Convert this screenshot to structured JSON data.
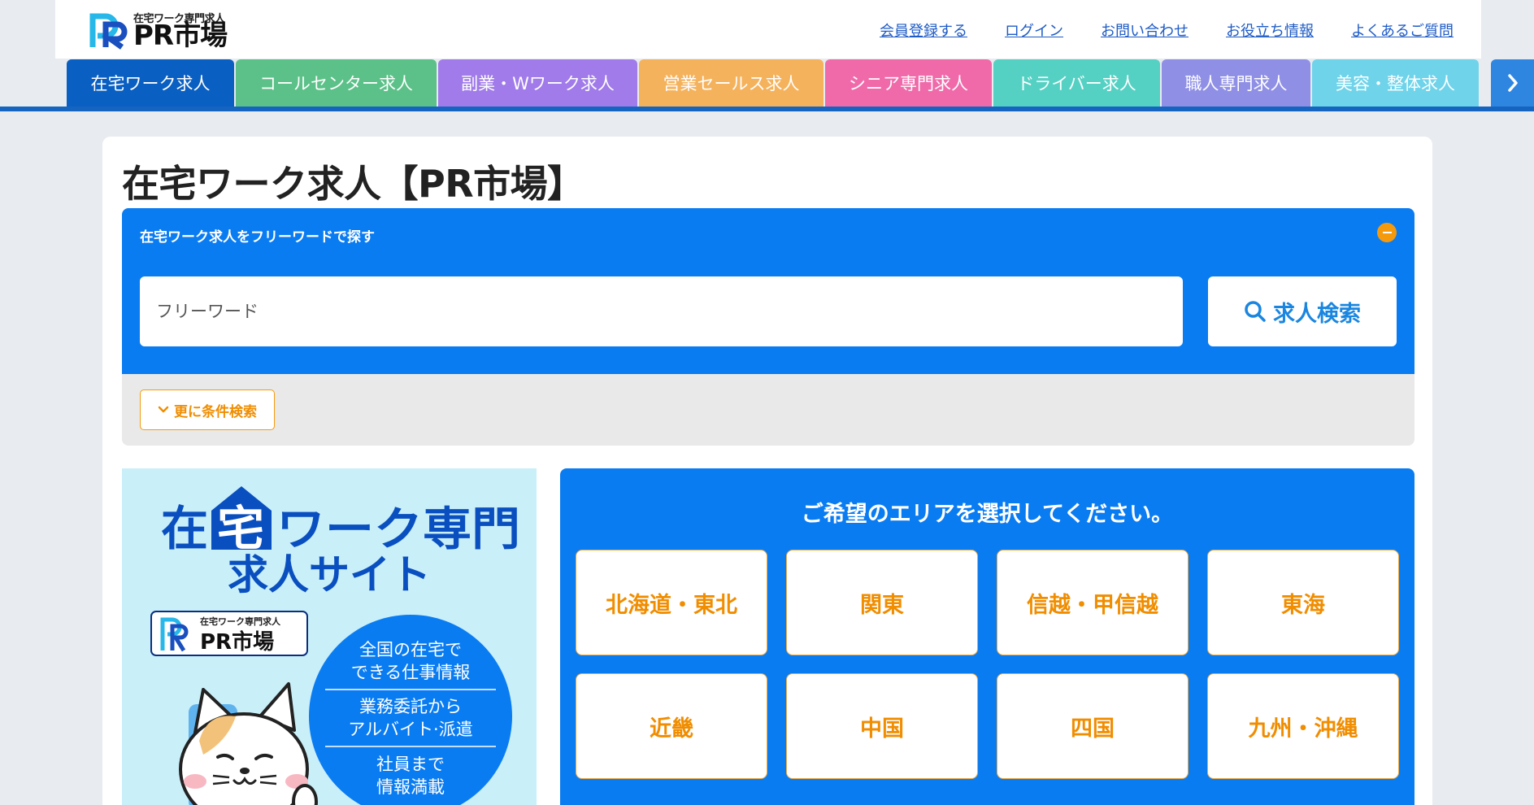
{
  "header": {
    "logo": {
      "sub": "在宅ワーク専門求人",
      "main": "PR市場"
    },
    "links": [
      "会員登録する",
      "ログイン",
      "お問い合わせ",
      "お役立ち情報",
      "よくあるご質問"
    ]
  },
  "tabs": [
    {
      "label": "在宅ワーク求人",
      "color": "#0a5fc2"
    },
    {
      "label": "コールセンター求人",
      "color": "#5cc188"
    },
    {
      "label": "副業・Wワーク求人",
      "color": "#a07be9"
    },
    {
      "label": "営業セールス求人",
      "color": "#f5b25c"
    },
    {
      "label": "シニア専門求人",
      "color": "#f06aaa"
    },
    {
      "label": "ドライバー求人",
      "color": "#55d1c4"
    },
    {
      "label": "職人専門求人",
      "color": "#8f8fe6"
    },
    {
      "label": "美容・整体求人",
      "color": "#6fd3ea"
    }
  ],
  "page": {
    "title": "在宅ワーク求人【PR市場】"
  },
  "search": {
    "label": "在宅ワーク求人をフリーワードで探す",
    "placeholder": "フリーワード",
    "button": "求人検索",
    "more": "更に条件検索"
  },
  "banner": {
    "title_line1_a": "在",
    "title_line1_b": "宅",
    "title_line1_c": "ワーク専門",
    "title_line2": "求人サイト",
    "logo_sub": "在宅ワーク専門求人",
    "logo_main": "PR市場",
    "features": [
      [
        "全国の在宅で",
        "できる仕事情報"
      ],
      [
        "業務委託から",
        "アルバイト·派遣"
      ],
      [
        "社員まで",
        "情報満載"
      ]
    ]
  },
  "areas": {
    "heading": "ご希望のエリアを選択してください。",
    "items": [
      "北海道・東北",
      "関東",
      "信越・甲信越",
      "東海",
      "近畿",
      "中国",
      "四国",
      "九州・沖縄"
    ]
  }
}
